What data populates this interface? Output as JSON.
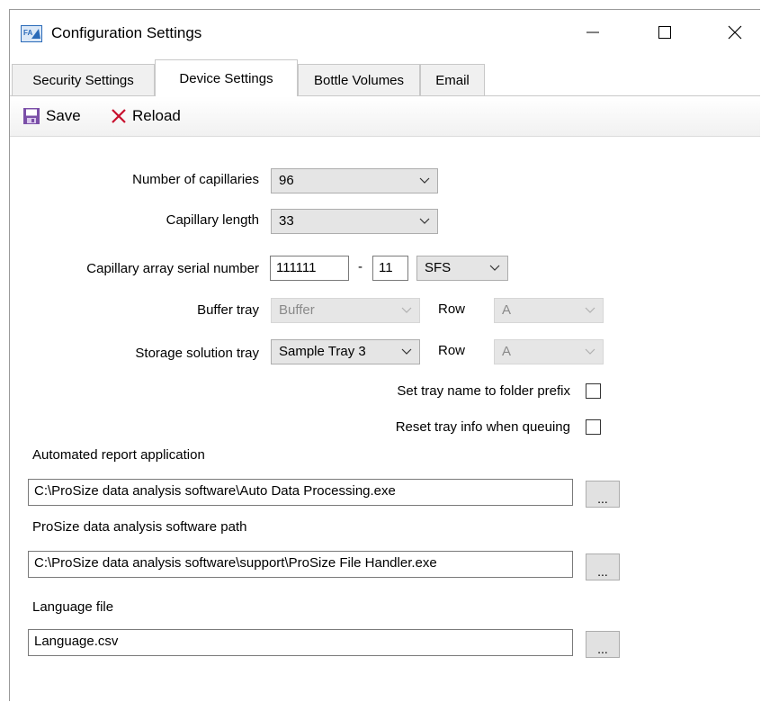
{
  "window": {
    "title": "Configuration Settings",
    "app_icon_text": "FA"
  },
  "tabs": [
    {
      "label": "Security Settings",
      "active": false
    },
    {
      "label": "Device Settings",
      "active": true
    },
    {
      "label": "Bottle Volumes",
      "active": false
    },
    {
      "label": "Email",
      "active": false
    }
  ],
  "toolbar": {
    "save_label": "Save",
    "reload_label": "Reload",
    "save_icon_color": "#7b4fa8",
    "reload_icon_color": "#c8102e"
  },
  "form": {
    "num_capillaries": {
      "label": "Number of capillaries",
      "value": "96"
    },
    "capillary_length": {
      "label": "Capillary length",
      "value": "33"
    },
    "serial": {
      "label": "Capillary array serial number",
      "part1": "111111",
      "separator": "-",
      "part2": "11",
      "suffix": "SFS"
    },
    "buffer_tray": {
      "label": "Buffer tray",
      "value": "Buffer",
      "row_label": "Row",
      "row_value": "A"
    },
    "storage_tray": {
      "label": "Storage solution tray",
      "value": "Sample Tray 3",
      "row_label": "Row",
      "row_value": "A"
    },
    "set_tray_name": {
      "label": "Set tray name to folder prefix",
      "checked": false
    },
    "reset_tray_info": {
      "label": "Reset tray info when queuing",
      "checked": false
    },
    "report_app": {
      "label": "Automated report application",
      "value": "C:\\ProSize data analysis software\\Auto Data Processing.exe",
      "browse": "..."
    },
    "prosize_path": {
      "label": "ProSize data analysis software path",
      "value": "C:\\ProSize data analysis software\\support\\ProSize File Handler.exe",
      "browse": "..."
    },
    "language_file": {
      "label": "Language file",
      "value": "Language.csv",
      "browse": "..."
    }
  }
}
